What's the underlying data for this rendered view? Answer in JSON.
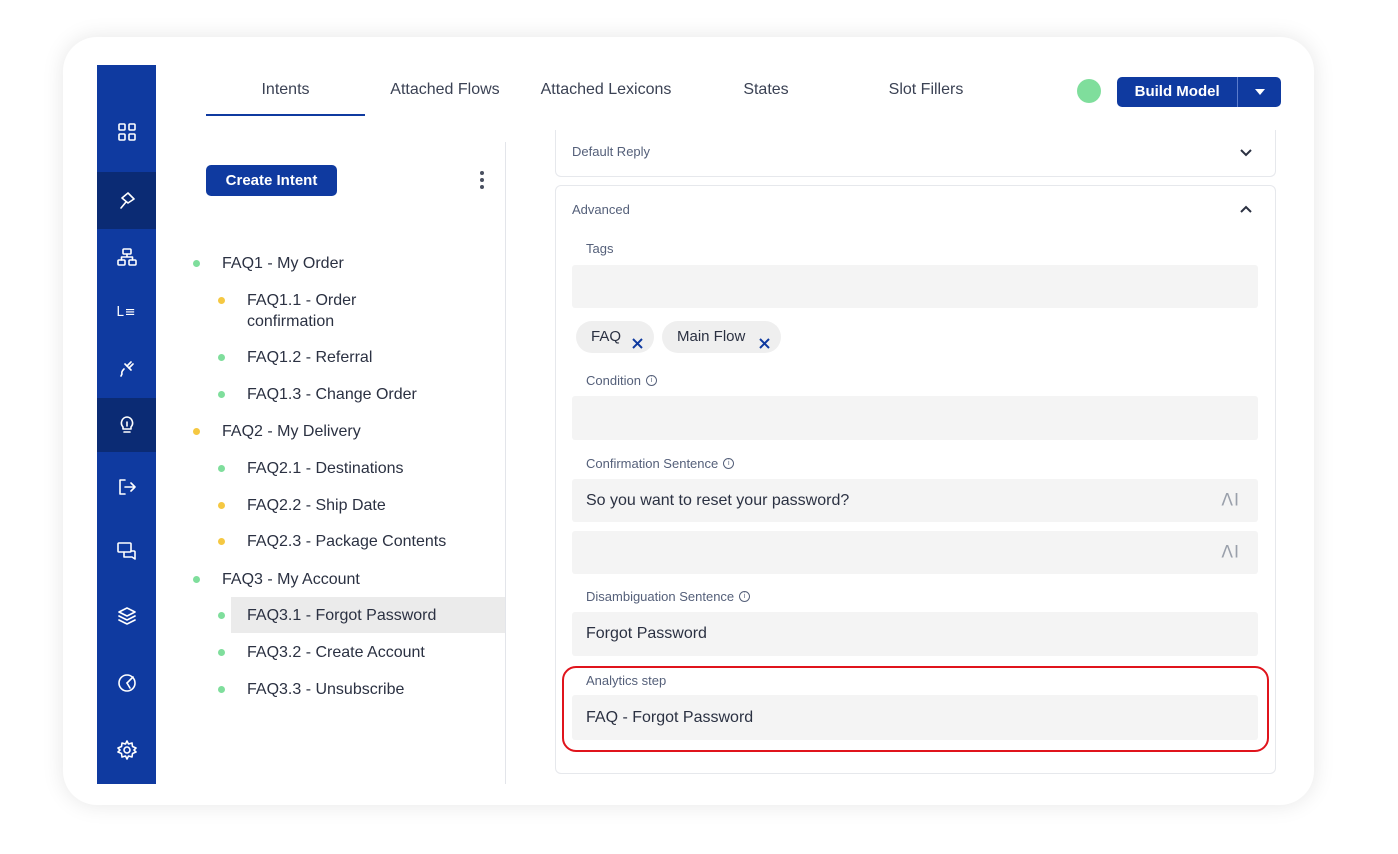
{
  "tabs": [
    {
      "label": "Intents"
    },
    {
      "label": "Attached Flows"
    },
    {
      "label": "Attached Lexicons"
    },
    {
      "label": "States"
    },
    {
      "label": "Slot Fillers"
    }
  ],
  "header": {
    "build_label": "Build Model"
  },
  "sidebar": {
    "lexicon_label": "L≡"
  },
  "intents": {
    "create_label": "Create Intent",
    "tree": [
      {
        "label": "FAQ1 - My Order",
        "status": "green",
        "level": 0
      },
      {
        "label": "FAQ1.1 - Order confirmation",
        "status": "yellow",
        "level": 1
      },
      {
        "label": "FAQ1.2 - Referral",
        "status": "green",
        "level": 1
      },
      {
        "label": "FAQ1.3 - Change Order",
        "status": "green",
        "level": 1
      },
      {
        "label": "FAQ2 - My Delivery",
        "status": "yellow",
        "level": 0
      },
      {
        "label": "FAQ2.1 - Destinations",
        "status": "green",
        "level": 1
      },
      {
        "label": "FAQ2.2 - Ship Date",
        "status": "yellow",
        "level": 1
      },
      {
        "label": "FAQ2.3 - Package Contents",
        "status": "yellow",
        "level": 1
      },
      {
        "label": "FAQ3 - My Account",
        "status": "green",
        "level": 0
      },
      {
        "label": "FAQ3.1 - Forgot Password",
        "status": "green",
        "level": 1,
        "selected": true
      },
      {
        "label": "FAQ3.2 - Create Account",
        "status": "green",
        "level": 1
      },
      {
        "label": "FAQ3.3 - Unsubscribe",
        "status": "green",
        "level": 1
      }
    ]
  },
  "details": {
    "default_reply_title": "Default Reply",
    "advanced_title": "Advanced",
    "tags_label": "Tags",
    "tags_value": "",
    "tags": [
      "FAQ",
      "Main Flow"
    ],
    "condition_label": "Condition",
    "condition_value": "",
    "confirmation_label": "Confirmation Sentence",
    "confirmation_values": [
      "So you want to reset your password?",
      ""
    ],
    "ai_glyph": "ΛI",
    "disambiguation_label": "Disambiguation Sentence",
    "disambiguation_value": "Forgot Password",
    "analytics_label": "Analytics step",
    "analytics_value": "FAQ - Forgot Password"
  },
  "colors": {
    "brand": "#0f3aa0",
    "status_green": "#7fde9c",
    "status_yellow": "#f5c842",
    "highlight": "#e0141c"
  },
  "icons": [
    "grid-icon",
    "pin-icon",
    "flow-icon",
    "lexicon-icon",
    "plug-icon",
    "bulb-icon",
    "logout-icon",
    "chat-icon",
    "layers-icon",
    "analytics-icon",
    "settings-icon"
  ]
}
